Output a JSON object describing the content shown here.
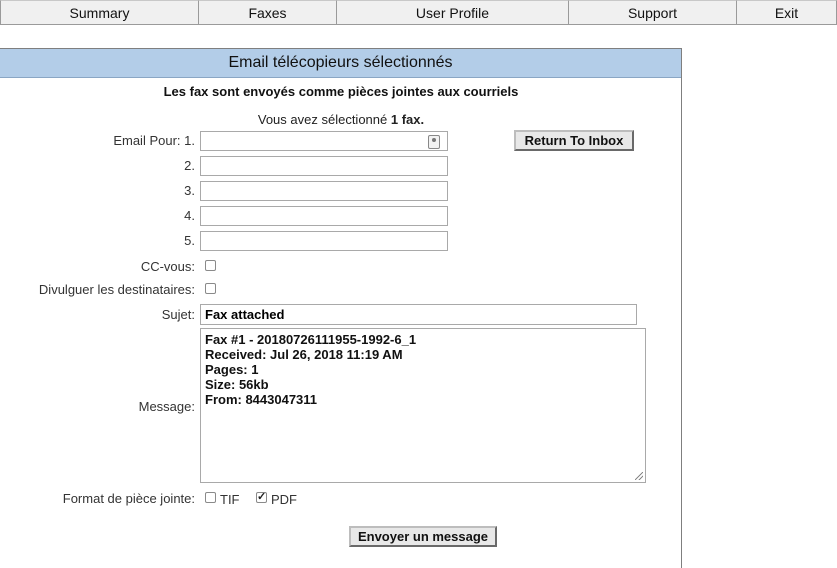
{
  "nav": {
    "items": [
      {
        "label": "Summary"
      },
      {
        "label": "Faxes"
      },
      {
        "label": "User Profile"
      },
      {
        "label": "Support"
      },
      {
        "label": "Exit"
      }
    ]
  },
  "panel": {
    "title": "Email télécopieurs sélectionnés",
    "subtitle": "Les fax sont envoyés comme pièces jointes aux courriels",
    "selection_prefix": "Vous avez sélectionné",
    "selection_count": "1 fax."
  },
  "form": {
    "email_label": "Email Pour:",
    "email_numbers": [
      "1.",
      "2.",
      "3.",
      "4.",
      "5."
    ],
    "email_values": [
      "",
      "",
      "",
      "",
      ""
    ],
    "return_button": "Return To Inbox",
    "cc_label": "CC-vous:",
    "cc_checked": false,
    "disclose_label": "Divulguer les destinataires:",
    "disclose_checked": false,
    "subject_label": "Sujet:",
    "subject_value": "Fax attached",
    "message_label": "Message:",
    "message_value": "Fax #1 - 20180726111955-1992-6_1\nReceived: Jul 26, 2018 11:19 AM\nPages: 1\nSize: 56kb\nFrom: 8443047311",
    "format_label": "Format de pièce jointe:",
    "format_options": [
      {
        "label": "TIF",
        "checked": false
      },
      {
        "label": "PDF",
        "checked": true
      }
    ],
    "send_button": "Envoyer un message"
  },
  "colors": {
    "header_bg": "#b3cde8",
    "nav_bg": "#f0f0f0"
  }
}
